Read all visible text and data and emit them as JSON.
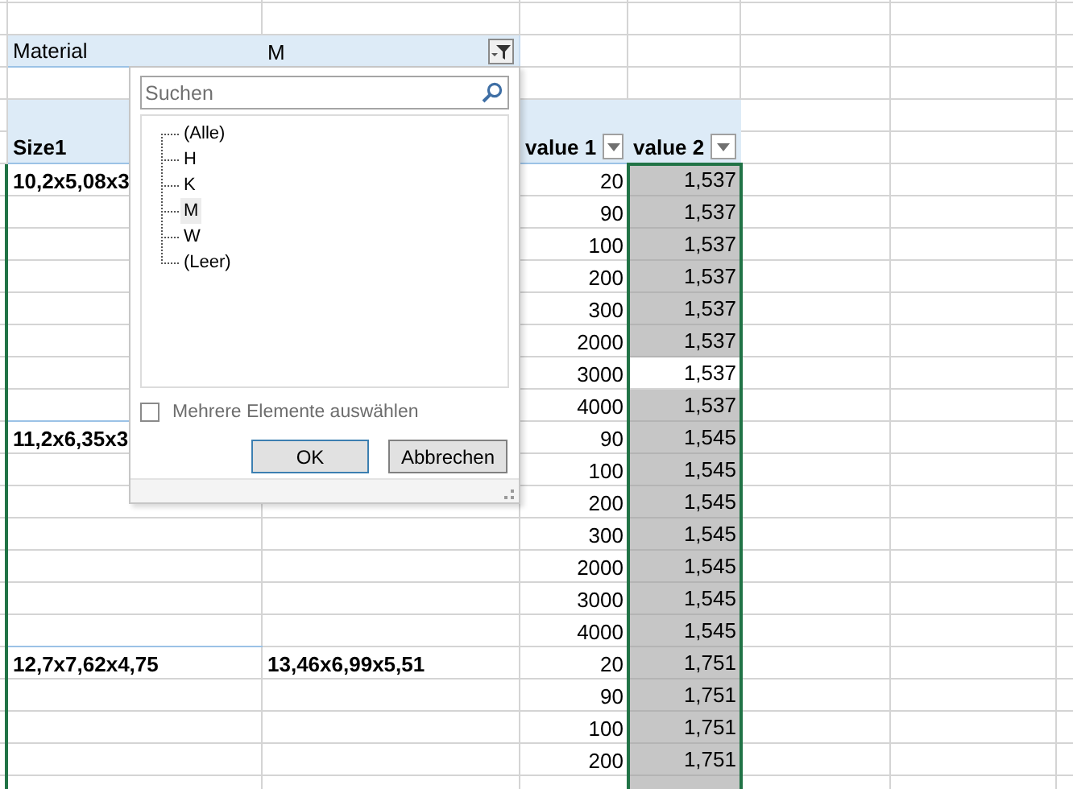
{
  "filter": {
    "label": "Material",
    "value": "M"
  },
  "pivot": {
    "columns": [
      {
        "label": "Size1",
        "dropdown": false
      },
      {
        "label": "value 1",
        "dropdown": true
      },
      {
        "label": "value 2",
        "dropdown": true
      }
    ],
    "groups": [
      {
        "size1": "10,2x5,08x3",
        "rows": [
          {
            "value1": "20",
            "value2": "1,537",
            "selected": true
          },
          {
            "value1": "90",
            "value2": "1,537",
            "selected": true
          },
          {
            "value1": "100",
            "value2": "1,537",
            "selected": true
          },
          {
            "value1": "200",
            "value2": "1,537",
            "selected": true
          },
          {
            "value1": "300",
            "value2": "1,537",
            "selected": true
          },
          {
            "value1": "2000",
            "value2": "1,537",
            "selected": true
          },
          {
            "value1": "3000",
            "value2": "1,537",
            "selected": false
          },
          {
            "value1": "4000",
            "value2": "1,537",
            "selected": true
          }
        ]
      },
      {
        "size1": "11,2x6,35x3",
        "rows": [
          {
            "value1": "90",
            "value2": "1,545",
            "selected": true
          },
          {
            "value1": "100",
            "value2": "1,545",
            "selected": true
          },
          {
            "value1": "200",
            "value2": "1,545",
            "selected": true
          },
          {
            "value1": "300",
            "value2": "1,545",
            "selected": true
          },
          {
            "value1": "2000",
            "value2": "1,545",
            "selected": true
          },
          {
            "value1": "3000",
            "value2": "1,545",
            "selected": true
          },
          {
            "value1": "4000",
            "value2": "1,545",
            "selected": true
          }
        ]
      },
      {
        "size1": "12,7x7,62x4,75",
        "size2": "13,46x6,99x5,51",
        "rows": [
          {
            "value1": "20",
            "value2": "1,751",
            "selected": true
          },
          {
            "value1": "90",
            "value2": "1,751",
            "selected": true
          },
          {
            "value1": "100",
            "value2": "1,751",
            "selected": true
          },
          {
            "value1": "200",
            "value2": "1,751",
            "selected": true
          }
        ]
      }
    ]
  },
  "popup": {
    "search": {
      "placeholder": "Suchen"
    },
    "items": [
      {
        "label": "(Alle)",
        "selected": false
      },
      {
        "label": "H",
        "selected": false
      },
      {
        "label": "K",
        "selected": false
      },
      {
        "label": "M",
        "selected": true
      },
      {
        "label": "W",
        "selected": false
      },
      {
        "label": "(Leer)",
        "selected": false
      }
    ],
    "multi_select": {
      "label": "Mehrere Elemente auswählen",
      "checked": false
    },
    "buttons": [
      {
        "label": "OK",
        "default": true
      },
      {
        "label": "Abbrechen",
        "default": false
      }
    ]
  }
}
